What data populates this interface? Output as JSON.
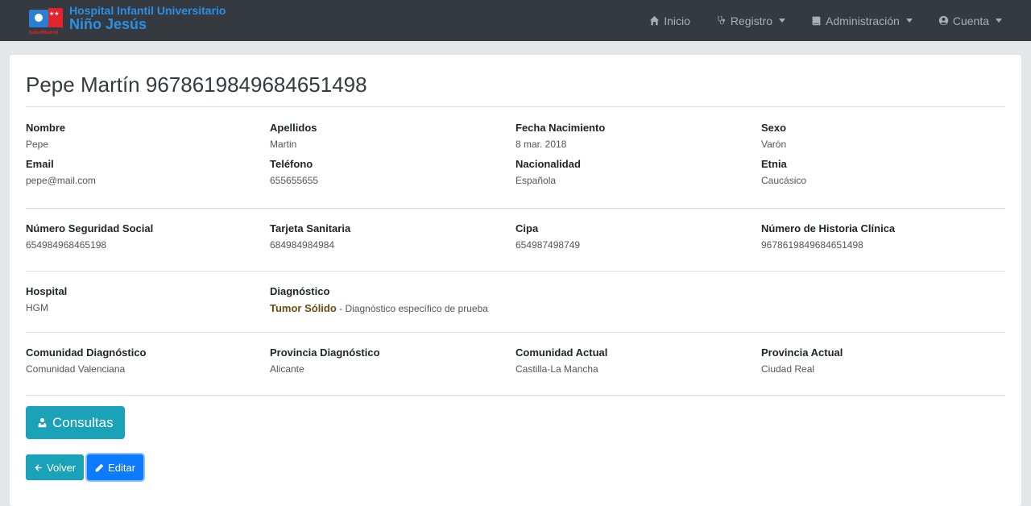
{
  "brand": {
    "line1": "Hospital Infantil Universitario",
    "line2": "Niño Jesús",
    "logo_sub": "SaludMadrid"
  },
  "nav": {
    "inicio": "Inicio",
    "registro": "Registro",
    "administracion": "Administración",
    "cuenta": "Cuenta"
  },
  "page": {
    "title": "Pepe Martín 9678619849684651498"
  },
  "personal": {
    "nombre": {
      "label": "Nombre",
      "value": "Pepe"
    },
    "apellidos": {
      "label": "Apellidos",
      "value": "Martin"
    },
    "fecha_nacimiento": {
      "label": "Fecha Nacimiento",
      "value": "8 mar. 2018"
    },
    "sexo": {
      "label": "Sexo",
      "value": "Varón"
    },
    "email": {
      "label": "Email",
      "value": "pepe@mail.com"
    },
    "telefono": {
      "label": "Teléfono",
      "value": "655655655"
    },
    "nacionalidad": {
      "label": "Nacionalidad",
      "value": "Española"
    },
    "etnia": {
      "label": "Etnia",
      "value": "Caucásico"
    }
  },
  "ids": {
    "nss": {
      "label": "Número Seguridad Social",
      "value": "654984968465198"
    },
    "tarjeta": {
      "label": "Tarjeta Sanitaria",
      "value": "684984984984"
    },
    "cipa": {
      "label": "Cipa",
      "value": "654987498749"
    },
    "historia": {
      "label": "Número de Historia Clínica",
      "value": "9678619849684651498"
    }
  },
  "clinical": {
    "hospital": {
      "label": "Hospital",
      "value": "HGM"
    },
    "diagnostico": {
      "label": "Diagnóstico",
      "main": "Tumor Sólido",
      "detail": " - Diagnóstico específico de prueba"
    }
  },
  "location": {
    "comunidad_diag": {
      "label": "Comunidad Diagnóstico",
      "value": "Comunidad Valenciana"
    },
    "provincia_diag": {
      "label": "Provincia Diagnóstico",
      "value": "Alicante"
    },
    "comunidad_actual": {
      "label": "Comunidad Actual",
      "value": "Castilla-La Mancha"
    },
    "provincia_actual": {
      "label": "Provincia Actual",
      "value": "Ciudad Real"
    }
  },
  "actions": {
    "consultas": "Consultas",
    "volver": "Volver",
    "editar": "Editar"
  },
  "colors": {
    "navbar": "#343a40",
    "brand": "#2c8fe6",
    "info": "#1aa2b8",
    "primary": "#0d7bff"
  }
}
